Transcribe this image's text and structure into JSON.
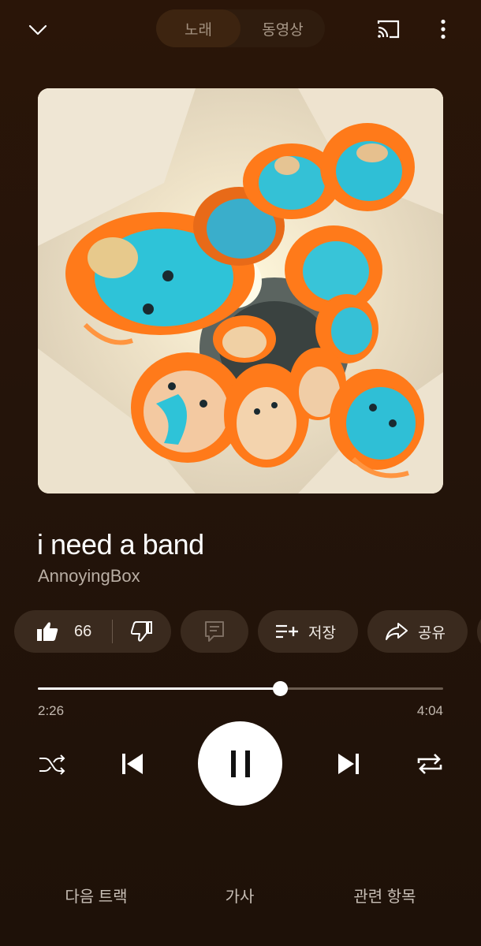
{
  "header": {
    "collapse_icon": "chevron-down-icon",
    "tabs": [
      {
        "label": "노래",
        "active": true
      },
      {
        "label": "동영상",
        "active": false
      }
    ],
    "cast_icon": "cast-icon",
    "more_icon": "more-vert-icon"
  },
  "album_art": {
    "colors": {
      "background": "#f2ead8",
      "wig": "#ff7a1a",
      "face": "#29c0d8"
    }
  },
  "track": {
    "title": "i need a band",
    "artist": "AnnoyingBox"
  },
  "actions": {
    "like_count": "66",
    "like_icon": "thumb-up-icon",
    "dislike_icon": "thumb-down-icon",
    "comment_icon": "comment-icon",
    "save_label": "저장",
    "save_icon": "playlist-add-icon",
    "share_label": "공유",
    "share_icon": "share-icon"
  },
  "progress": {
    "current": "2:26",
    "total": "4:04",
    "fraction": 0.598
  },
  "controls": {
    "shuffle_icon": "shuffle-icon",
    "prev_icon": "skip-previous-icon",
    "play_state_icon": "pause-icon",
    "next_icon": "skip-next-icon",
    "repeat_icon": "repeat-icon"
  },
  "bottom_tabs": [
    {
      "label": "다음 트랙"
    },
    {
      "label": "가사"
    },
    {
      "label": "관련 항목"
    }
  ],
  "colors": {
    "background": "#24140a",
    "chip": "#3a2a1e",
    "accent": "#ffffff"
  }
}
